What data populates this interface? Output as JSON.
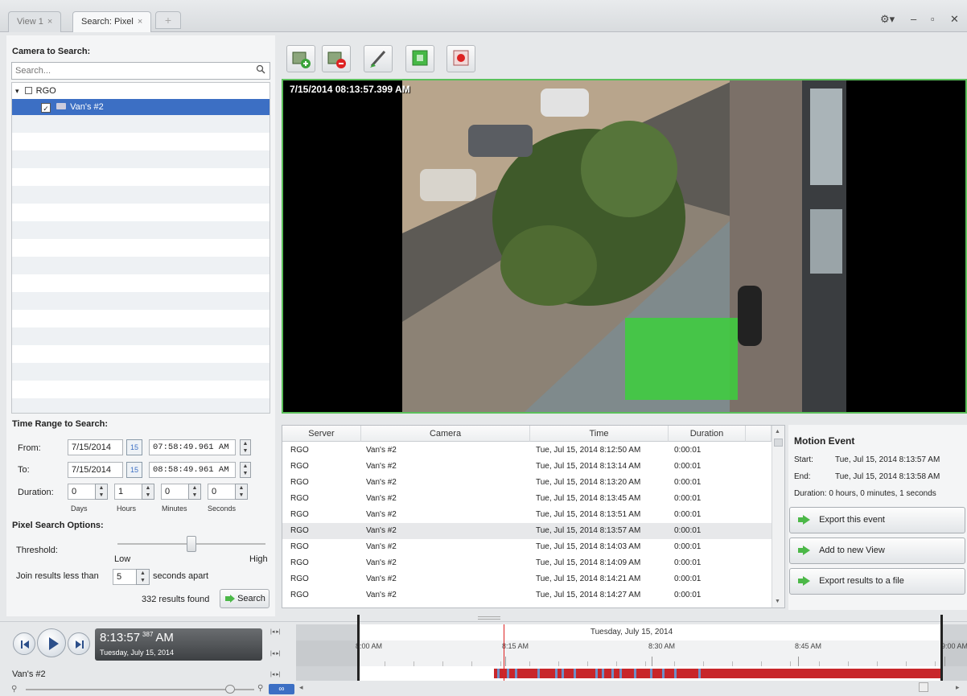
{
  "tabs": [
    {
      "label": "View 1",
      "close": "×"
    },
    {
      "label": "Search: Pixel",
      "close": "×"
    }
  ],
  "tab_add": "+",
  "window_controls": {
    "settings": "⚙▾",
    "minimize": "–",
    "maximize": "▫",
    "close": "✕"
  },
  "left": {
    "camera_title": "Camera to Search:",
    "search_placeholder": "Search...",
    "search_icon": "search-icon",
    "tree": {
      "server": {
        "expander": "▾",
        "label": "RGO"
      },
      "camera": {
        "checked": "✓",
        "label": "Van's #2"
      }
    },
    "time_title": "Time Range to Search:",
    "from_label": "From:",
    "from_date": "7/15/2014",
    "from_time": "07:58:49.961 AM",
    "to_label": "To:",
    "to_date": "7/15/2014",
    "to_time": "08:58:49.961 AM",
    "cal_num": "15",
    "duration_label": "Duration:",
    "duration": {
      "days": "0",
      "hours": "1",
      "minutes": "0",
      "seconds": "0"
    },
    "duration_units": {
      "days": "Days",
      "hours": "Hours",
      "minutes": "Minutes",
      "seconds": "Seconds"
    },
    "pixel_title": "Pixel Search Options:",
    "threshold_label": "Threshold:",
    "threshold_low": "Low",
    "threshold_high": "High",
    "threshold_level": 0.5,
    "join_label": "Join results less than",
    "join_value": "5",
    "join_suffix": "seconds apart",
    "results_found": "332",
    "results_found_label": "results found",
    "search_button": "Search"
  },
  "toolbar": {
    "icons": [
      "add-region-icon",
      "remove-region-icon",
      "draw-mask-icon",
      "select-all-icon",
      "stop-record-icon"
    ]
  },
  "video": {
    "timestamp": "7/15/2014 08:13:57.399 AM"
  },
  "results_table": {
    "columns": [
      "Server",
      "Camera",
      "Time",
      "Duration"
    ],
    "rows": [
      {
        "server": "RGO",
        "camera": "Van's #2",
        "time": "Tue, Jul 15, 2014 8:12:50 AM",
        "duration": "0:00:01"
      },
      {
        "server": "RGO",
        "camera": "Van's #2",
        "time": "Tue, Jul 15, 2014 8:13:14 AM",
        "duration": "0:00:01"
      },
      {
        "server": "RGO",
        "camera": "Van's #2",
        "time": "Tue, Jul 15, 2014 8:13:20 AM",
        "duration": "0:00:01"
      },
      {
        "server": "RGO",
        "camera": "Van's #2",
        "time": "Tue, Jul 15, 2014 8:13:45 AM",
        "duration": "0:00:01"
      },
      {
        "server": "RGO",
        "camera": "Van's #2",
        "time": "Tue, Jul 15, 2014 8:13:51 AM",
        "duration": "0:00:01"
      },
      {
        "server": "RGO",
        "camera": "Van's #2",
        "time": "Tue, Jul 15, 2014 8:13:57 AM",
        "duration": "0:00:01"
      },
      {
        "server": "RGO",
        "camera": "Van's #2",
        "time": "Tue, Jul 15, 2014 8:14:03 AM",
        "duration": "0:00:01"
      },
      {
        "server": "RGO",
        "camera": "Van's #2",
        "time": "Tue, Jul 15, 2014 8:14:09 AM",
        "duration": "0:00:01"
      },
      {
        "server": "RGO",
        "camera": "Van's #2",
        "time": "Tue, Jul 15, 2014 8:14:21 AM",
        "duration": "0:00:01"
      },
      {
        "server": "RGO",
        "camera": "Van's #2",
        "time": "Tue, Jul 15, 2014 8:14:27 AM",
        "duration": "0:00:01"
      }
    ],
    "selected_row": 5
  },
  "motion_event": {
    "title": "Motion Event",
    "start_label": "Start:",
    "start_value": "Tue, Jul 15, 2014 8:13:57 AM",
    "end_label": "End:",
    "end_value": "Tue, Jul 15, 2014 8:13:58 AM",
    "duration": "Duration: 0 hours, 0 minutes, 1 seconds",
    "buttons": [
      "Export this event",
      "Add to new View",
      "Export results to a file"
    ]
  },
  "playback": {
    "clock_time": "8:13:57",
    "clock_ms": "387",
    "clock_ampm": "AM",
    "clock_date": "Tuesday, July 15, 2014",
    "camera_label": "Van's #2",
    "timeline_date": "Tuesday, July 15, 2014",
    "timeline_ticks": [
      "8:00 AM",
      "8:15 AM",
      "8:30 AM",
      "8:45 AM",
      "9:00 AM"
    ],
    "nav_symbols": "|◂ ▸|",
    "link_label": "∞",
    "scroll_left": "◂",
    "scroll_right": "▸"
  },
  "colors": {
    "selection": "#3c6fc4",
    "video_border": "#5bbf5b",
    "motion_green": "#3ccf3c",
    "timeline_red": "#c8262a",
    "green_arrow": "#4cb848"
  }
}
